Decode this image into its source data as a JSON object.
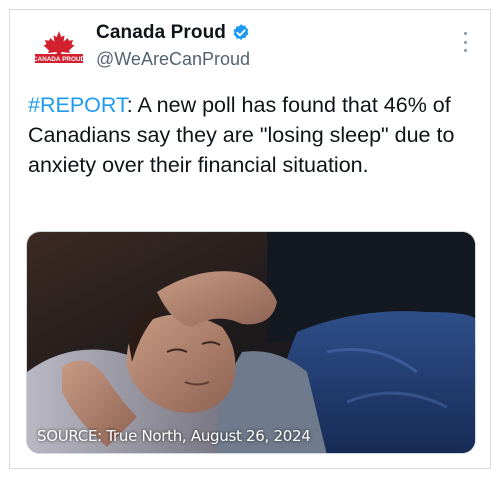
{
  "author": {
    "display_name": "Canada Proud",
    "handle": "@WeAreCanProud",
    "avatar_label": "CANADA PROUD",
    "verified": true
  },
  "tweet": {
    "hashtag": "#REPORT",
    "body": ": A new poll has found that 46% of Canadians say they are \"losing sleep\" due to anxiety over their financial situation."
  },
  "media": {
    "caption": "SOURCE: True North, August 26, 2024"
  },
  "colors": {
    "accent": "#1d9bf0",
    "text": "#0f1419",
    "secondary": "#536471",
    "logo_red": "#d3202f"
  },
  "icons": {
    "verified": "verified-badge-icon",
    "more": "more-options-icon"
  }
}
